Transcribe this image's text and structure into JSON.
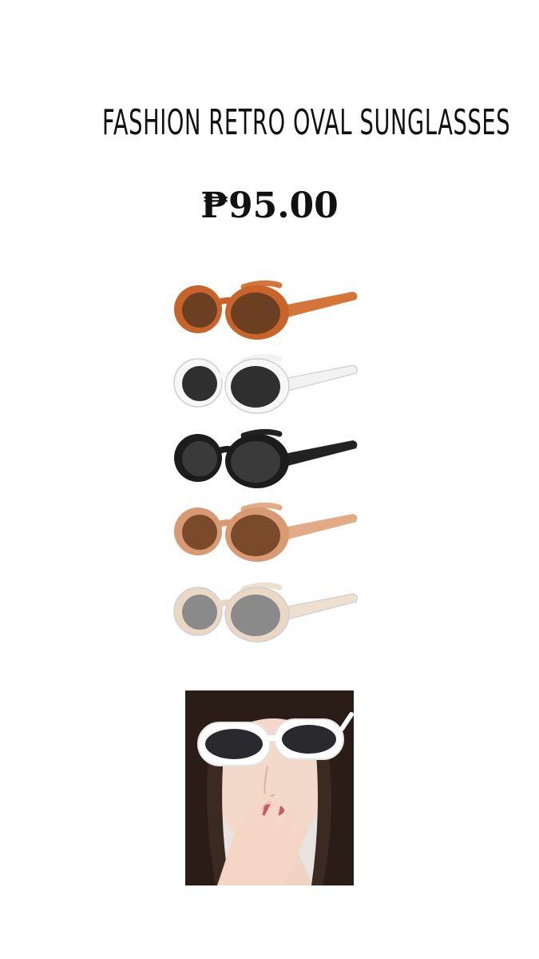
{
  "product": {
    "title": "FASHION RETRO OVAL SUNGLASSES",
    "price": "₱95.00"
  },
  "variants": [
    {
      "name": "orange-tortoise",
      "frame": "#c8632a",
      "lens": "#6b3f22",
      "temple": "#d4753a"
    },
    {
      "name": "white",
      "frame": "#f7f7f7",
      "lens": "#2f2f2f",
      "temple": "#f2f2f2"
    },
    {
      "name": "black",
      "frame": "#1c1c1c",
      "lens": "#3a3a3a",
      "temple": "#222222"
    },
    {
      "name": "tan",
      "frame": "#d79a72",
      "lens": "#7a4a2a",
      "temple": "#e2aa85"
    },
    {
      "name": "clear-champagne",
      "frame": "#ead8c4",
      "lens": "#8a8a8a",
      "temple": "#eedfcf"
    }
  ],
  "model_photo": {
    "icon": "model-wearing-white-oval-sunglasses"
  }
}
